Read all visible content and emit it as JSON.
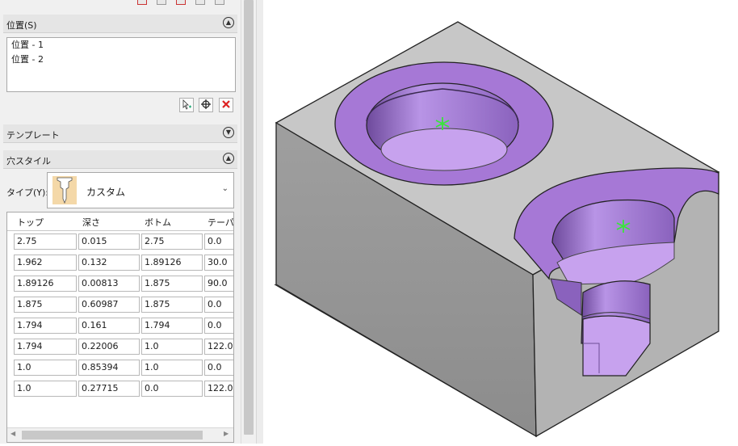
{
  "panel": {
    "position_section": {
      "title": "位置(S)",
      "items": [
        "位置 - 1",
        "位置 - 2"
      ]
    },
    "template_section": {
      "title": "テンプレート"
    },
    "hole_style_section": {
      "title": "穴スタイル",
      "type_label": "タイプ(Y):",
      "type_value": "カスタム"
    },
    "table": {
      "headers": [
        "トップ",
        "深さ",
        "ボトム",
        "テーパー"
      ],
      "rows": [
        [
          "2.75",
          "0.015",
          "2.75",
          "0.0"
        ],
        [
          "1.962",
          "0.132",
          "1.89126",
          "30.0"
        ],
        [
          "1.89126",
          "0.00813",
          "1.875",
          "90.0"
        ],
        [
          "1.875",
          "0.60987",
          "1.875",
          "0.0"
        ],
        [
          "1.794",
          "0.161",
          "1.794",
          "0.0"
        ],
        [
          "1.794",
          "0.22006",
          "1.0",
          "122.0"
        ],
        [
          "1.0",
          "0.85394",
          "1.0",
          "0.0"
        ],
        [
          "1.0",
          "0.27715",
          "0.0",
          "122.0"
        ]
      ]
    },
    "icons": [
      "select-add-icon",
      "crosshair-icon",
      "delete-x-icon"
    ]
  },
  "colors": {
    "panel_bg": "#f0f0f0",
    "block_top": "#c9c9c9",
    "block_front": "#9a9a9a",
    "block_side": "#b5b5b5",
    "hole_purple": "#a678d6",
    "hole_light": "#c7a2ee",
    "origin_marker": "#39e639",
    "delete_red": "#d22"
  }
}
